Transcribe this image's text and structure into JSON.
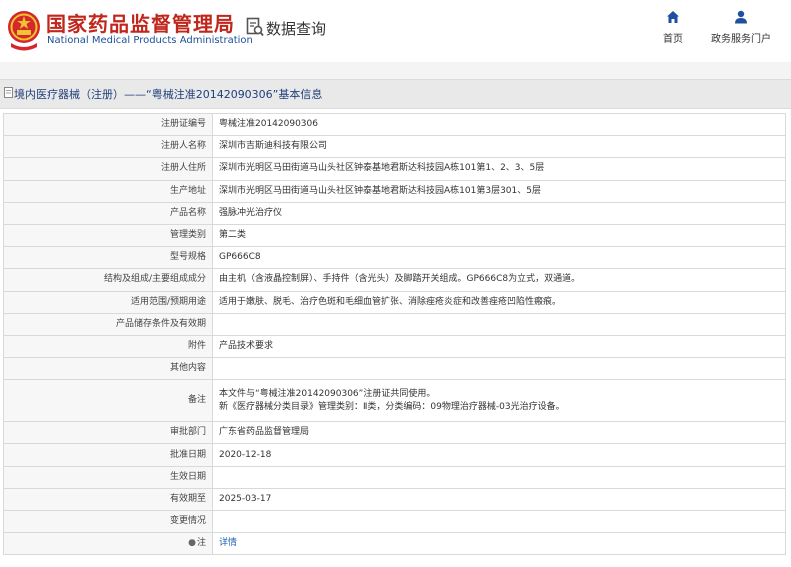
{
  "header": {
    "brand_cn": "国家药品监督管理局",
    "brand_en": "National Medical Products Administration",
    "data_query": "数据查询",
    "nav_home": "首页",
    "nav_portal": "政务服务门户",
    "brand_color": "#c0261c",
    "accent_color": "#1c4f99"
  },
  "breadcrumb": "境内医疗器械（注册）——“粤械注准20142090306”基本信息",
  "rows": [
    {
      "label": "注册证编号",
      "value": "粤械注准20142090306"
    },
    {
      "label": "注册人名称",
      "value": "深圳市吉斯迪科技有限公司"
    },
    {
      "label": "注册人住所",
      "value": "深圳市光明区马田街道马山头社区钟泰基地君斯达科技园A栋101第1、2、3、5层"
    },
    {
      "label": "生产地址",
      "value": "深圳市光明区马田街道马山头社区钟泰基地君斯达科技园A栋101第3层301、5层"
    },
    {
      "label": "产品名称",
      "value": "强脉冲光治疗仪"
    },
    {
      "label": "管理类别",
      "value": "第二类"
    },
    {
      "label": "型号规格",
      "value": "GP666C8"
    },
    {
      "label": "结构及组成/主要组成成分",
      "value": "由主机（含液晶控制屏）、手持件（含光头）及脚踏开关组成。GP666C8为立式，双通道。"
    },
    {
      "label": "适用范围/预期用途",
      "value": "适用于嫩肤、脱毛、治疗色斑和毛细血管扩张、消除痤疮炎症和改善痤疮凹陷性瘢痕。"
    },
    {
      "label": "产品储存条件及有效期",
      "value": ""
    },
    {
      "label": "附件",
      "value": "产品技术要求"
    },
    {
      "label": "其他内容",
      "value": ""
    }
  ],
  "remark": {
    "label": "备注",
    "line1": "本文件与“粤械注准20142090306”注册证共同使用。",
    "line2": "新《医疗器械分类目录》管理类别：Ⅱ类，分类编码：09物理治疗器械-03光治疗设备。"
  },
  "rows2": [
    {
      "label": "审批部门",
      "value": "广东省药品监督管理局"
    },
    {
      "label": "批准日期",
      "value": "2020-12-18"
    },
    {
      "label": "生效日期",
      "value": ""
    },
    {
      "label": "有效期至",
      "value": "2025-03-17"
    },
    {
      "label": "变更情况",
      "value": ""
    }
  ],
  "note": {
    "label": "注",
    "link": "详情"
  }
}
